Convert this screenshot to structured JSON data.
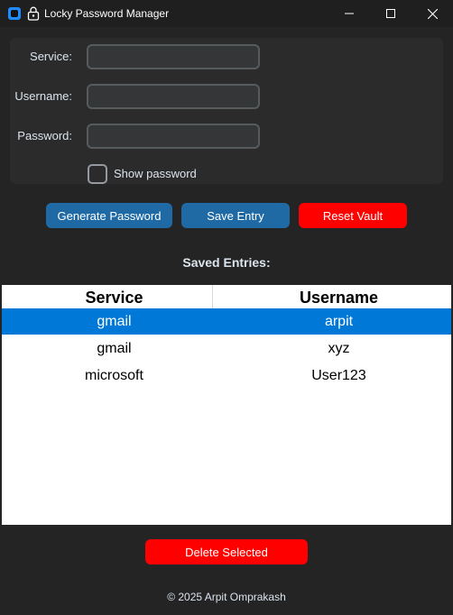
{
  "window": {
    "title": "Locky Password Manager"
  },
  "form": {
    "service_label": "Service:",
    "service_value": "",
    "username_label": "Username:",
    "username_value": "",
    "password_label": "Password:",
    "password_value": "",
    "show_password_label": "Show password",
    "show_password_checked": false
  },
  "actions": {
    "generate_label": "Generate Password",
    "save_label": "Save Entry",
    "reset_label": "Reset Vault"
  },
  "entries": {
    "heading": "Saved Entries:",
    "columns": [
      "Service",
      "Username"
    ],
    "rows": [
      {
        "service": "gmail",
        "username": "arpit",
        "selected": true
      },
      {
        "service": "gmail",
        "username": "xyz",
        "selected": false
      },
      {
        "service": "microsoft",
        "username": "User123",
        "selected": false
      }
    ]
  },
  "delete_label": "Delete Selected",
  "footer": "© 2025 Arpit Omprakash",
  "colors": {
    "accent_blue": "#1f6aa5",
    "danger_red": "#ff0000",
    "selection_blue": "#0078d7",
    "background": "#242424"
  }
}
